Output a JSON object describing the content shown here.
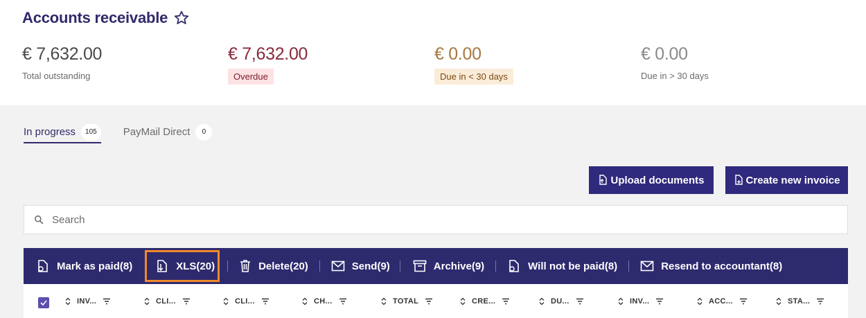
{
  "header": {
    "title": "Accounts receivable",
    "favorite_icon": "star-icon"
  },
  "summary": [
    {
      "amount": "€ 7,632.00",
      "label": "Total outstanding",
      "amount_color": "#4a4a4a"
    },
    {
      "amount": "€ 7,632.00",
      "label": "Overdue",
      "amount_color": "#8a2a3c",
      "chip_bg": "#fde2e4"
    },
    {
      "amount": "€ 0.00",
      "label": "Due in < 30 days",
      "amount_color": "#a8773f",
      "chip_bg": "#fbecd8"
    },
    {
      "amount": "€ 0.00",
      "label": "Due in > 30 days",
      "amount_color": "#8a8a8a"
    }
  ],
  "tabs": [
    {
      "label": "In progress",
      "count": "105",
      "active": true
    },
    {
      "label": "PayMail Direct",
      "count": "0",
      "active": false
    }
  ],
  "buttons": {
    "upload": "Upload documents",
    "create": "Create new invoice"
  },
  "search": {
    "placeholder": "Search"
  },
  "actions": [
    {
      "label": "Mark as paid(8)",
      "icon": "mark-paid-icon"
    },
    {
      "label": "XLS(20)",
      "icon": "download-file-icon",
      "highlighted": true
    },
    {
      "label": "Delete(20)",
      "icon": "trash-icon"
    },
    {
      "label": "Send(9)",
      "icon": "envelope-icon"
    },
    {
      "label": "Archive(9)",
      "icon": "archive-icon"
    },
    {
      "label": "Will not be paid(8)",
      "icon": "will-not-pay-icon"
    },
    {
      "label": "Resend to accountant(8)",
      "icon": "envelope-icon"
    }
  ],
  "table": {
    "select_all_checked": true,
    "columns": [
      "INV...",
      "CLI...",
      "CLI...",
      "CH...",
      "TOTAL",
      "CRE...",
      "DU...",
      "INV...",
      "ACC...",
      "STA..."
    ]
  },
  "colors": {
    "brand": "#2f2a6b",
    "action_bar": "#2e2a6e",
    "button": "#2f2a7d",
    "highlight": "#f08a2c"
  }
}
